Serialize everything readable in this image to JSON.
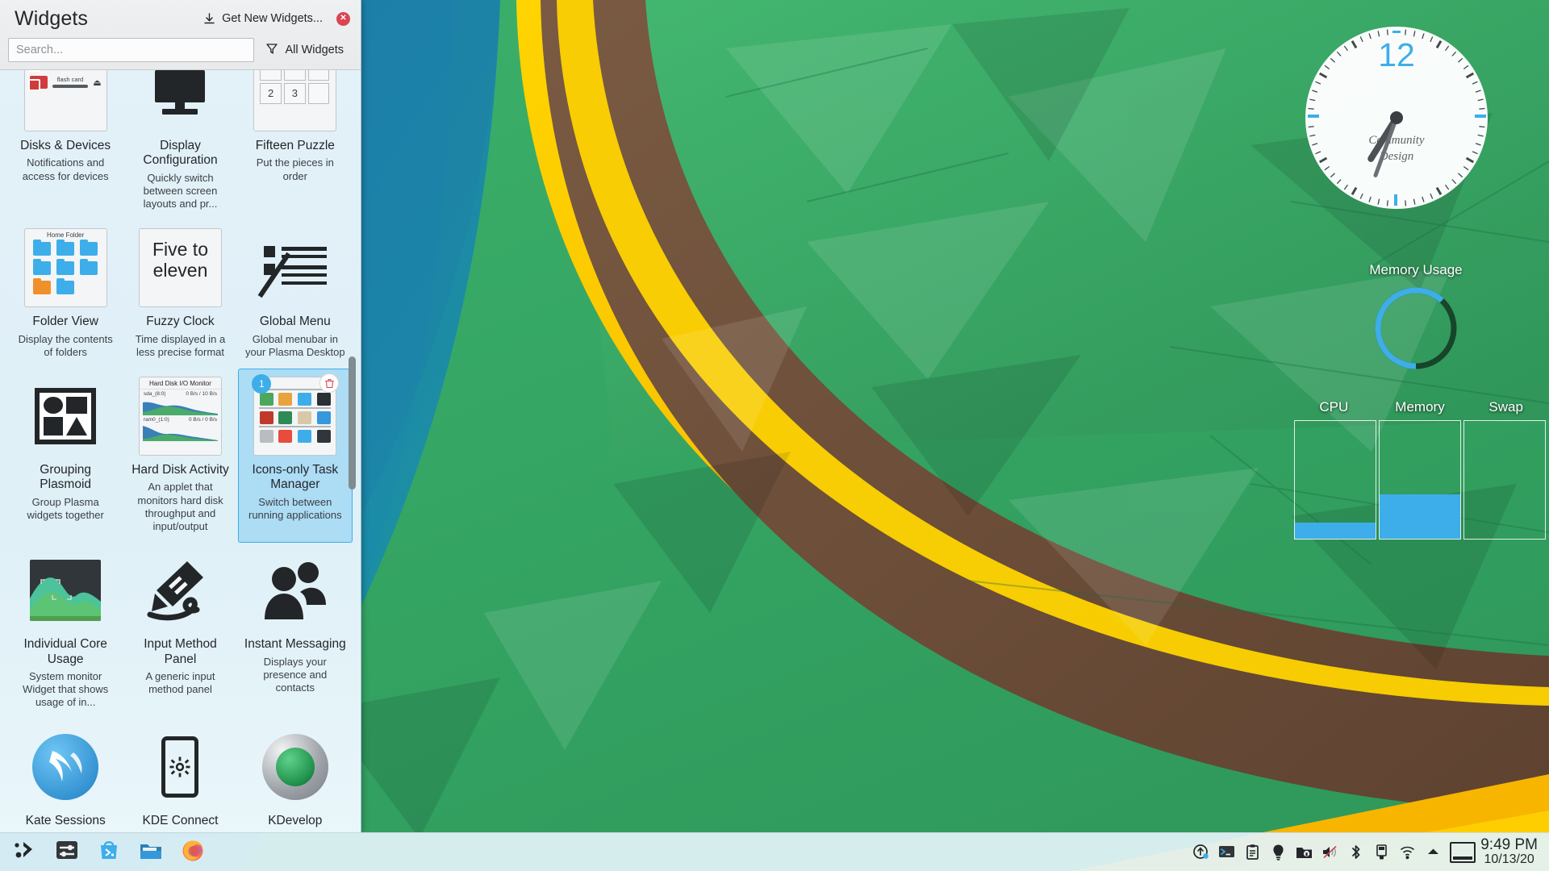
{
  "window": {
    "title": "Widgets",
    "get_new_label": "Get New Widgets...",
    "close_label": "✕",
    "search_placeholder": "Search...",
    "search_value": "",
    "filter_label": "All Widgets"
  },
  "widgets": [
    {
      "name": "Disks & Devices",
      "desc": "Notifications and access for devices",
      "thumb": "disks",
      "selected": false
    },
    {
      "name": "Display Configuration",
      "desc": "Quickly switch between screen layouts and pr...",
      "thumb": "display",
      "selected": false
    },
    {
      "name": "Fifteen Puzzle",
      "desc": "Put the pieces in order",
      "thumb": "puzzle",
      "selected": false
    },
    {
      "name": "Folder View",
      "desc": "Display the contents of folders",
      "thumb": "folderview",
      "selected": false
    },
    {
      "name": "Fuzzy Clock",
      "desc": "Time displayed in a less precise format",
      "thumb": "fuzzy",
      "selected": false
    },
    {
      "name": "Global Menu",
      "desc": "Global menubar in your Plasma Desktop",
      "thumb": "globalmenu",
      "selected": false
    },
    {
      "name": "Grouping Plasmoid",
      "desc": "Group Plasma widgets together",
      "thumb": "grouping",
      "selected": false
    },
    {
      "name": "Hard Disk Activity",
      "desc": "An applet that monitors hard disk throughput and input/output",
      "thumb": "harddisk",
      "selected": false
    },
    {
      "name": "Icons-only Task Manager",
      "desc": "Switch between running applications",
      "thumb": "taskmanager",
      "selected": true
    },
    {
      "name": "Individual Core Usage",
      "desc": "System monitor Widget that shows usage of in...",
      "thumb": "corusage",
      "selected": false
    },
    {
      "name": "Input Method Panel",
      "desc": "A generic input method panel",
      "thumb": "inputmethod",
      "selected": false
    },
    {
      "name": "Instant Messaging",
      "desc": "Displays your presence and contacts",
      "thumb": "instantmsg",
      "selected": false
    },
    {
      "name": "Kate Sessions",
      "desc": "",
      "thumb": "kate",
      "selected": false
    },
    {
      "name": "KDE Connect",
      "desc": "",
      "thumb": "kdeconnect",
      "selected": false
    },
    {
      "name": "KDevelop",
      "desc": "",
      "thumb": "kdevelop",
      "selected": false
    }
  ],
  "widget_previews": {
    "fuzzy_text_line1": "Five to",
    "fuzzy_text_line2": "eleven",
    "folder_view_title": "Home Folder",
    "disks_device_label": "flash card",
    "hard_disk_title": "Hard Disk I/O Monitor",
    "hard_disk_dev1": "sda_(8:0)",
    "hard_disk_rate1": "0 B/s / 10 B/s",
    "hard_disk_dev2": "ram0_(1:0)",
    "hard_disk_rate2": "0 B/s / 0 B/s",
    "puzzle_tiles": [
      "",
      "",
      "",
      "2",
      "3",
      ""
    ],
    "task_manager_badge": "1"
  },
  "desktop": {
    "clock": {
      "hour_label": "12",
      "brand_line1": "Community",
      "brand_line2": "Design",
      "hour_angle_deg": -58,
      "minute_angle_deg": -62
    },
    "memory_usage": {
      "title": "Memory Usage",
      "percent": 62,
      "ring_color": "#3daee9"
    },
    "system_monitor": {
      "bars": [
        {
          "label": "CPU",
          "percent": 14
        },
        {
          "label": "Memory",
          "percent": 38
        },
        {
          "label": "Swap",
          "percent": 0
        }
      ],
      "fill_color": "#3daee9"
    }
  },
  "taskbar": {
    "launchers": [
      {
        "name": "application-launcher",
        "label": "Application Launcher"
      },
      {
        "name": "system-settings",
        "label": "System Settings"
      },
      {
        "name": "discover",
        "label": "Discover"
      },
      {
        "name": "file-manager",
        "label": "Dolphin File Manager"
      },
      {
        "name": "firefox",
        "label": "Firefox"
      }
    ],
    "tray_icons": [
      "updates-icon",
      "terminal-icon",
      "clipboard-icon",
      "notifications-icon",
      "vault-icon",
      "volume-muted-icon",
      "bluetooth-icon",
      "removable-media-icon",
      "network-wifi-icon",
      "show-hidden-icon"
    ],
    "pager_label": "Pager",
    "clock_time": "9:49 PM",
    "clock_date": "10/13/20"
  },
  "colors": {
    "accent": "#3daee9",
    "selection_bg": "#addcf5",
    "panel_bg": "#dff0f7",
    "close_red": "#da4453",
    "text": "#232629"
  }
}
